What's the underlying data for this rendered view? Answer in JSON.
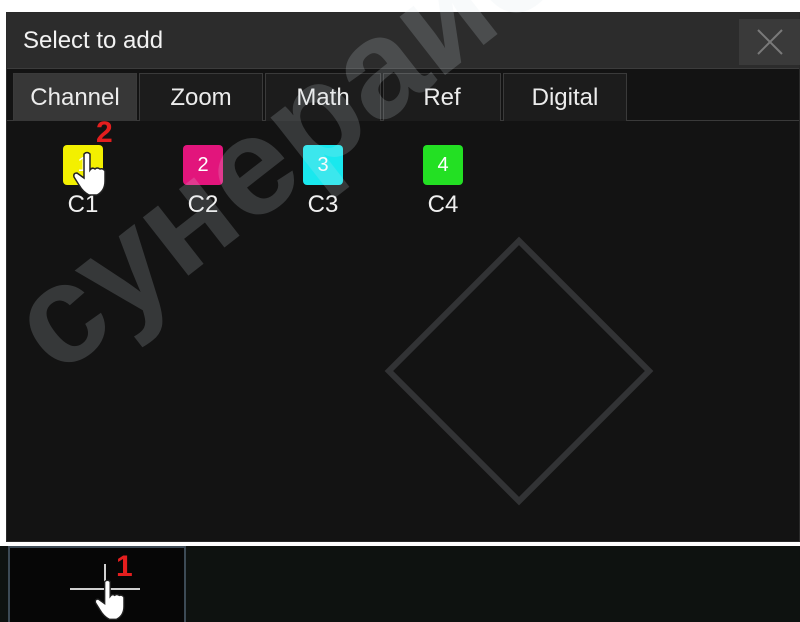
{
  "dialog": {
    "title": "Select to add",
    "close_icon": "close-icon"
  },
  "tabs": [
    {
      "label": "Channel",
      "active": true
    },
    {
      "label": "Zoom",
      "active": false
    },
    {
      "label": "Math",
      "active": false
    },
    {
      "label": "Ref",
      "active": false
    },
    {
      "label": "Digital",
      "active": false
    }
  ],
  "channels": [
    {
      "number": "1",
      "label": "C1",
      "color": "#f3f000"
    },
    {
      "number": "2",
      "label": "C2",
      "color": "#e2157c"
    },
    {
      "number": "3",
      "label": "C3",
      "color": "#19e8ee"
    },
    {
      "number": "4",
      "label": "C4",
      "color": "#23e023"
    }
  ],
  "annotations": {
    "step1": "1",
    "step2": "2"
  },
  "add_slot_icon": "crosshair-plus-icon",
  "pointer_icon": "hand-pointer-icon",
  "colors": {
    "dialog_bg": "#131313",
    "titlebar_bg": "#2c2c2c",
    "annotation": "#e41e1e"
  },
  "watermark": {
    "text": "сунерайс",
    "logo": "gear-logo"
  }
}
